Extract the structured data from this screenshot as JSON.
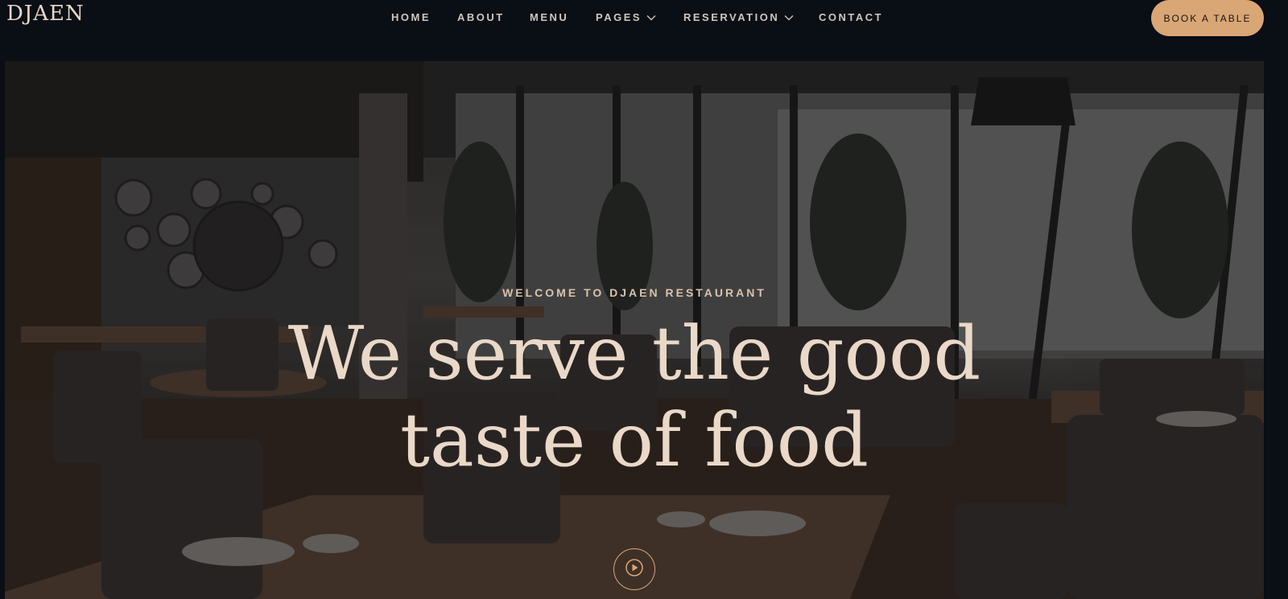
{
  "header": {
    "logo": "DJAEN",
    "nav": [
      {
        "label": "HOME",
        "has_dropdown": false
      },
      {
        "label": "ABOUT",
        "has_dropdown": false
      },
      {
        "label": "MENU",
        "has_dropdown": false
      },
      {
        "label": "PAGES",
        "has_dropdown": true
      },
      {
        "label": "RESERVATION",
        "has_dropdown": true
      },
      {
        "label": "CONTACT",
        "has_dropdown": false
      }
    ],
    "cta_label": "BOOK A TABLE"
  },
  "hero": {
    "eyebrow": "WELCOME TO DJAEN RESTAURANT",
    "headline_line1": "We serve the good",
    "headline_line2": "taste of food",
    "play_icon": "play-icon"
  },
  "colors": {
    "background": "#0a0e15",
    "accent": "#d9a676",
    "headline": "#ead8c8",
    "nav_text": "#cfc6bd"
  }
}
